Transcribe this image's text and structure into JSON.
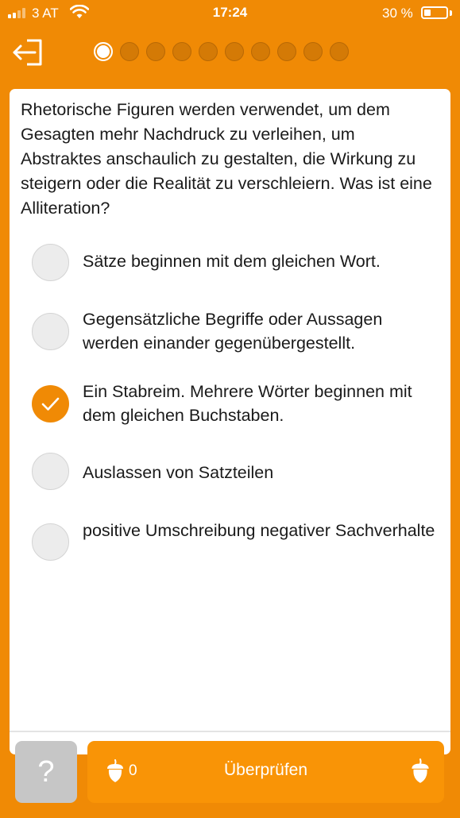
{
  "status_bar": {
    "carrier": "3 AT",
    "time": "17:24",
    "battery_percent": "30 %",
    "battery_level": 0.3
  },
  "nav": {
    "exit_icon": "exit-door-arrow-icon",
    "progress_total": 10,
    "progress_current": 1
  },
  "quiz": {
    "question": "Rhetorische Figuren werden verwendet, um dem Gesagten mehr Nachdruck zu verleihen, um Abstraktes anschaulich zu gestalten, die Wirkung zu steigern oder die Realität zu verschleiern. Was ist eine Alliteration?",
    "answers": [
      {
        "label": "Sätze beginnen mit dem gleichen Wort.",
        "selected": false
      },
      {
        "label": "Gegensätzliche Begriffe oder Aussagen werden einander gegenübergestellt.",
        "selected": false
      },
      {
        "label": "Ein Stabreim. Mehrere Wörter beginnen mit dem gleichen Buchstaben.",
        "selected": true
      },
      {
        "label": "Auslassen von Satzteilen",
        "selected": false
      },
      {
        "label": "positive Umschreibung negativer Sachverhalte",
        "selected": false
      }
    ]
  },
  "bottom_bar": {
    "hint_label": "?",
    "acorn_count": "0",
    "check_label": "Überprüfen",
    "acorn_icon": "acorn-icon"
  },
  "colors": {
    "accent": "#f08a05",
    "button": "#f99406",
    "hint_button": "#c6c6c6"
  }
}
